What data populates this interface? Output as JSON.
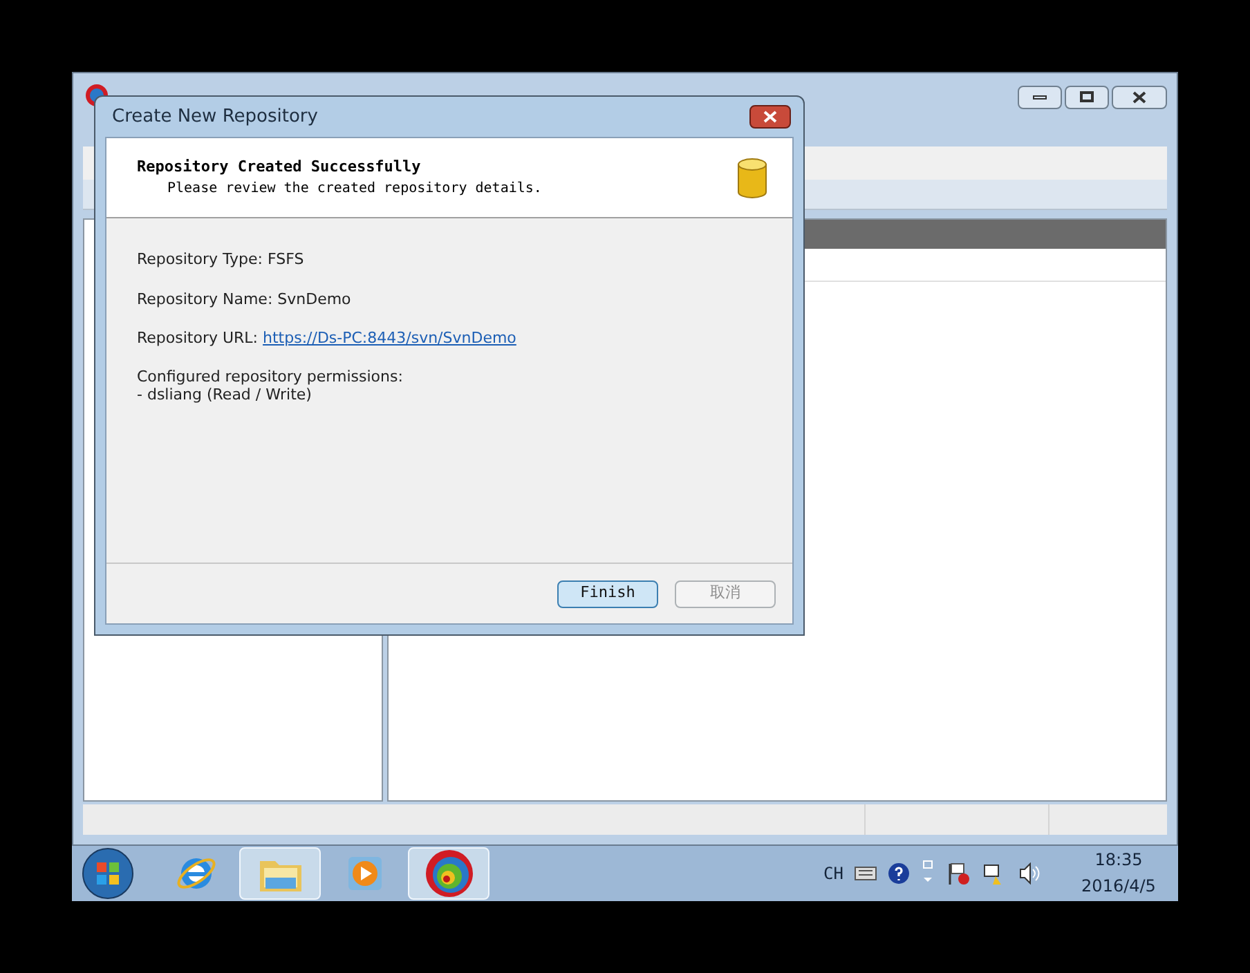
{
  "dialog": {
    "title": "Create New Repository",
    "header_title": "Repository Created Successfully",
    "header_subtitle": "Please review the created repository details.",
    "details": [
      {
        "kind": "text",
        "label": "Repository Type: FSFS"
      },
      {
        "kind": "text",
        "label": "Repository Name: SvnDemo"
      },
      {
        "kind": "link",
        "label": "Repository URL: ",
        "link": "https://Ds-PC:8443/svn/SvnDemo"
      },
      {
        "kind": "multiline",
        "lines": [
          "Configured repository permissions:",
          "- dsliang (Read / Write)"
        ]
      }
    ],
    "buttons": [
      {
        "label": "Finish",
        "disabled": false,
        "focused": true
      },
      {
        "label": "取消",
        "disabled": true,
        "focused": false
      }
    ]
  },
  "taskbar": {
    "items": [
      {
        "kind": "ie",
        "selected": false
      },
      {
        "kind": "explorer",
        "selected": true
      },
      {
        "kind": "media",
        "selected": false
      },
      {
        "kind": "svn",
        "selected": true
      }
    ],
    "language": "CH",
    "time": "18:35",
    "date": "2016/4/5"
  }
}
